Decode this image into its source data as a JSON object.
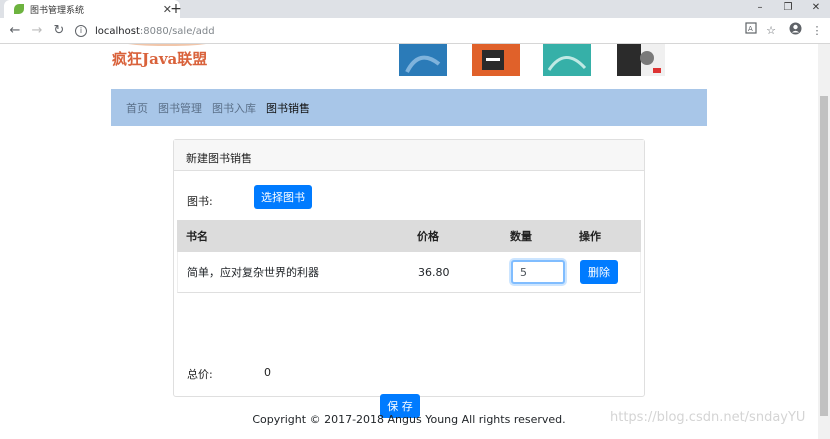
{
  "browser": {
    "tab_title": "图书管理系统",
    "close_glyph": "✕",
    "newtab_glyph": "+",
    "win_min": "–",
    "win_restore": "❐",
    "win_close": "✕",
    "url_host": "localhost",
    "url_path": ":8080/sale/add",
    "icons": [
      "back-icon",
      "forward-icon",
      "reload-icon",
      "info-icon",
      "translate-icon",
      "star-icon",
      "account-icon",
      "menu-icon"
    ]
  },
  "site": {
    "logo_text": "疯狂Java联盟",
    "cover_colors": [
      "#2b7bb8",
      "#e0612a",
      "#36b0a8",
      "#5a5a5a"
    ]
  },
  "nav": {
    "items": [
      {
        "label": "首页"
      },
      {
        "label": "图书管理"
      },
      {
        "label": "图书入库"
      },
      {
        "label": "图书销售"
      }
    ]
  },
  "card": {
    "header": "新建图书销售",
    "book_label": "图书:",
    "select_button": "选择图书",
    "columns": [
      "书名",
      "价格",
      "数量",
      "操作"
    ],
    "rows": [
      {
        "name": "简单，应对复杂世界的利器",
        "price": "36.80",
        "qty": "5",
        "action": "删除"
      }
    ],
    "total_label": "总价:",
    "total_value": "0",
    "save_button": "保 存"
  },
  "footer": {
    "text": "Copyright © 2017-2018 Angus Young All rights reserved."
  },
  "watermark": "https://blog.csdn.net/sndayYU",
  "colors": {
    "primary": "#007bff",
    "navbar": "#a8c6e8"
  }
}
